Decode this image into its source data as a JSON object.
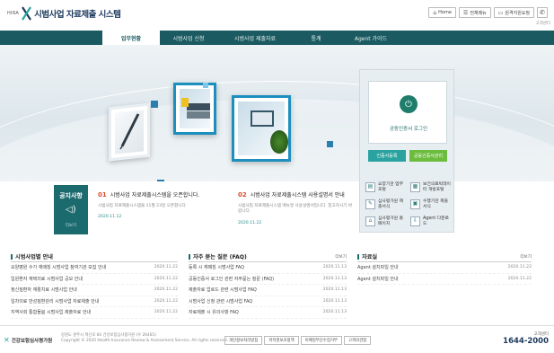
{
  "header": {
    "small_logo": "HIRA",
    "site_title": "시범사업 자료제출 시스템",
    "links": [
      {
        "label": "Home",
        "icon": "home-icon"
      },
      {
        "label": "전체메뉴",
        "icon": "menu-icon"
      },
      {
        "label": "원격지원요청",
        "icon": "monitor-icon"
      }
    ],
    "sub_text": "고객센터"
  },
  "nav": {
    "items": [
      "업무현황",
      "시범사업 신청",
      "시범사업 제출자료",
      "통계",
      "Agent 가이드"
    ]
  },
  "login": {
    "label": "공동인증서 로그인",
    "btn_register": "인증서등록",
    "btn_manage": "공동인증서관리",
    "quick": [
      {
        "label": "요양기관 업무포털",
        "icon": "portal-icon"
      },
      {
        "label": "보건의료빅데이터 개방포털",
        "icon": "data-icon"
      },
      {
        "label": "심사평가원 제출서식",
        "icon": "form-icon"
      },
      {
        "label": "수행기관 제출서식",
        "icon": "doc-icon"
      },
      {
        "label": "심사평가원 홈페이지",
        "icon": "home-icon"
      },
      {
        "label": "Agent 다운로드",
        "icon": "download-icon"
      }
    ]
  },
  "notice": {
    "tag": "공지사항",
    "more": "더보기",
    "items": [
      {
        "num": "01",
        "title": "시범사업 자료제출시스템을 오픈합니다.",
        "desc": "시범사업 자료제출시스템을 11월 23일 오픈합니다.",
        "date": "2020.11.12"
      },
      {
        "num": "02",
        "title": "시범사업 자료제출시스템 사용설명서 안내",
        "desc": "시범사업 자료제출시스템 매뉴얼 사용설명서입니다. 참고하시기 바랍니다.",
        "date": "2020.11.22"
      }
    ]
  },
  "boards": [
    {
      "title": "시범사업별 안내",
      "more": "",
      "rows": [
        {
          "text": "요양병원 수가 재매칭 시범사업 참여기관 모집 안내",
          "date": "2020.11.22"
        },
        {
          "text": "입원환자 재택의료 시범사업 공모 안내",
          "date": "2020.11.22"
        },
        {
          "text": "정신질환자 재활치료 시범사업 안내",
          "date": "2020.11.22"
        },
        {
          "text": "일차의료 만성질환관리 시범사업 자료제출 안내",
          "date": "2020.11.22"
        },
        {
          "text": "지역사회 통합돌봄 시범사업 제출자료 안내",
          "date": "2020.11.22"
        }
      ]
    },
    {
      "title": "자주 묻는 질문 (FAQ)",
      "more": "더보기",
      "rows": [
        {
          "text": "등록 시 재매칭 시범사업 FAQ",
          "date": "2020.11.13"
        },
        {
          "text": "공동인증서 로그인 관련 자주묻는 질문 (FAQ)",
          "date": "2020.11.13"
        },
        {
          "text": "제출자료 업로드 관련 시범사업 FAQ",
          "date": "2020.11.13"
        },
        {
          "text": "시범사업 신청 관련 시범사업 FAQ",
          "date": "2020.11.13"
        },
        {
          "text": "자료제출 시 유의사항 FAQ",
          "date": "2020.11.13"
        }
      ]
    },
    {
      "title": "자료실",
      "more": "더보기",
      "rows": [
        {
          "text": "Agent 설치파일 안내",
          "date": "2020.11.22"
        },
        {
          "text": "Agent 설치파일 안내",
          "date": "2020.11.22"
        }
      ]
    }
  ],
  "footer": {
    "org": "건강보험심사평가원",
    "info_line1": "강원도 원주시 혁신로 60 건강보험심사평가원 (우 26465)",
    "info_line2": "Copyright © 2020 Health Insurance Review & Assessment Service. All rights reserved.",
    "links": [
      "개인정보처리방침",
      "저작권보호정책",
      "이메일무단수집거부",
      "고객의견함"
    ],
    "call_label": "고객센터",
    "call_number": "1644-2000"
  },
  "colors": {
    "nav": "#1b5a61",
    "accent": "#2aa3a0",
    "green": "#6cbc3d",
    "notice_num": "#d84b2a"
  }
}
